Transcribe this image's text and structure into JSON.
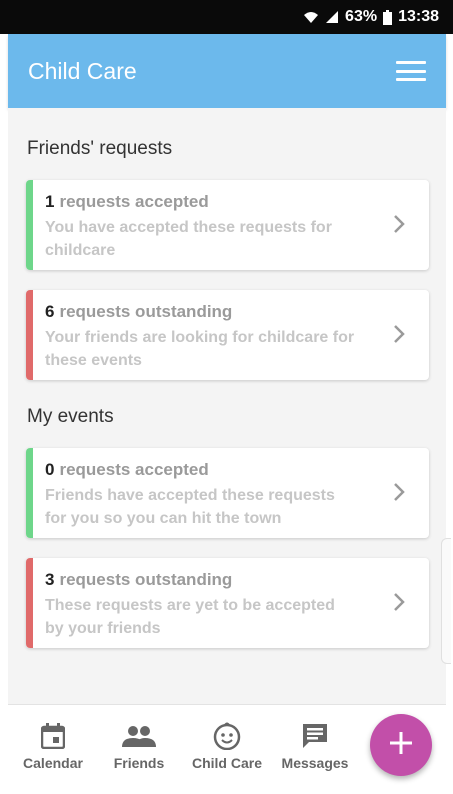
{
  "status_bar": {
    "battery": "63%",
    "time": "13:38"
  },
  "app_bar": {
    "title": "Child Care",
    "menu_icon": "hamburger-menu-icon"
  },
  "sections": [
    {
      "title": "Friends' requests",
      "cards": [
        {
          "count": "1",
          "label": "requests accepted",
          "description": "You have accepted these requests for childcare",
          "status_color": "#6ed68a"
        },
        {
          "count": "6",
          "label": "requests outstanding",
          "description": "Your friends are looking for childcare for these events",
          "status_color": "#e06a6a"
        }
      ]
    },
    {
      "title": "My events",
      "cards": [
        {
          "count": "0",
          "label": "requests accepted",
          "description": "Friends have accepted these requests for you so you can hit the town",
          "status_color": "#6ed68a"
        },
        {
          "count": "3",
          "label": "requests outstanding",
          "description": "These requests are yet to be accepted by your friends",
          "status_color": "#e06a6a"
        }
      ]
    }
  ],
  "bottom_nav": [
    {
      "label": "Calendar",
      "icon": "calendar-icon"
    },
    {
      "label": "Friends",
      "icon": "friends-icon"
    },
    {
      "label": "Child Care",
      "icon": "baby-face-icon"
    },
    {
      "label": "Messages",
      "icon": "message-icon"
    }
  ],
  "fab": {
    "icon": "plus-icon",
    "color": "#c24fa9"
  },
  "colors": {
    "app_bar": "#6cb9ec",
    "accepted": "#6ed68a",
    "outstanding": "#e06a6a"
  }
}
